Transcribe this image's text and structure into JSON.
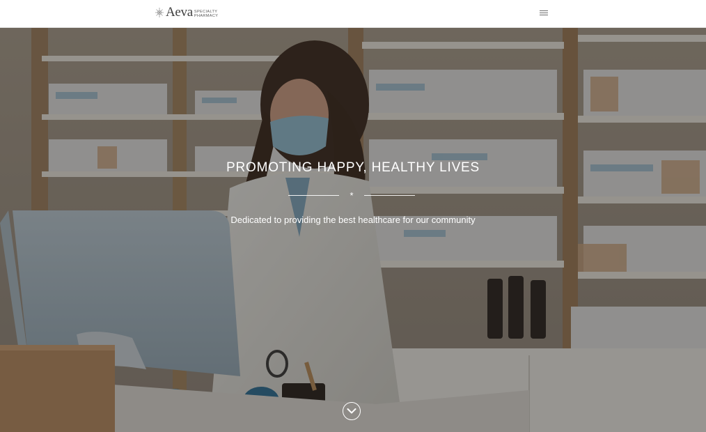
{
  "header": {
    "logo": {
      "word": "Aeva",
      "sub_line1": "SPECIALTY",
      "sub_line2": "PHARMACY",
      "icon": "leaf-sun-icon"
    },
    "menu_icon": "hamburger-menu-icon"
  },
  "hero": {
    "title": "PROMOTING HAPPY, HEALTHY LIVES",
    "divider_glyph": "*",
    "subtitle": "Dedicated to providing the best healthcare for our community",
    "scroll_icon": "chevron-down-icon",
    "background": "pharmacist-at-counter-photo"
  },
  "colors": {
    "header_bg": "#ffffff",
    "hero_text": "#ffffff",
    "logo_text": "#3f3f3f"
  }
}
